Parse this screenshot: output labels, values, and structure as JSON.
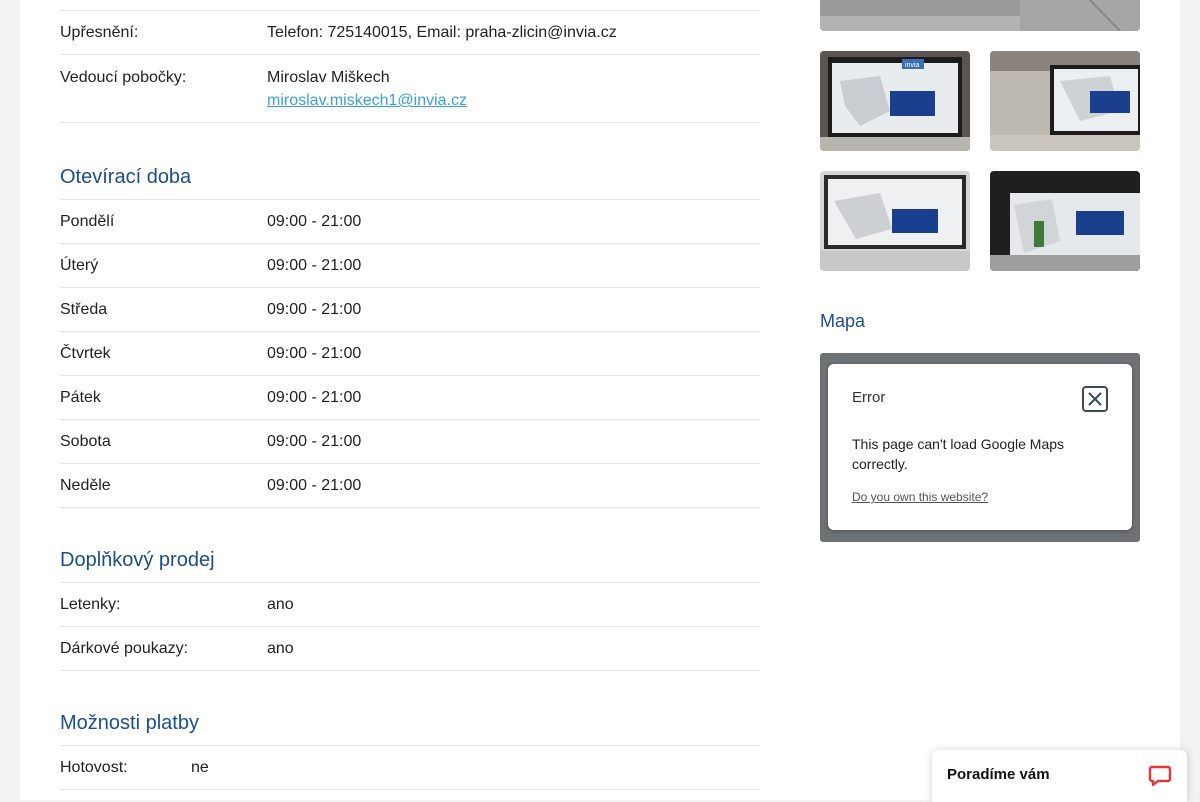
{
  "contact": {
    "upresneni_label": "Upřesnění:",
    "upresneni_value": "Telefon: 725140015, Email: praha-zlicin@invia.cz",
    "manager_label": "Vedoucí pobočky:",
    "manager_name": "Miroslav Miškech",
    "manager_email": "miroslav.miskech1@invia.cz"
  },
  "opening_hours": {
    "title": "Otevírací doba",
    "days": [
      {
        "day": "Pondělí",
        "hours": "09:00 - 21:00"
      },
      {
        "day": "Úterý",
        "hours": "09:00 - 21:00"
      },
      {
        "day": "Středa",
        "hours": "09:00 - 21:00"
      },
      {
        "day": "Čtvrtek",
        "hours": "09:00 - 21:00"
      },
      {
        "day": "Pátek",
        "hours": "09:00 - 21:00"
      },
      {
        "day": "Sobota",
        "hours": "09:00 - 21:00"
      },
      {
        "day": "Neděle",
        "hours": "09:00 - 21:00"
      }
    ]
  },
  "extra_sales": {
    "title": "Doplňkový prodej",
    "items": [
      {
        "label": "Letenky:",
        "value": "ano"
      },
      {
        "label": "Dárkové poukazy:",
        "value": "ano"
      }
    ]
  },
  "payment": {
    "title": "Možnosti platby",
    "items": [
      {
        "label": "Hotovost:",
        "value": "ne"
      }
    ]
  },
  "gallery": {
    "logo_text": "invia"
  },
  "map": {
    "title": "Mapa",
    "error_title": "Error",
    "error_message": "This page can't load Google Maps correctly.",
    "error_link": "Do you own this website?"
  },
  "chat": {
    "label": "Poradíme vám"
  },
  "colors": {
    "heading": "#1b4f8c",
    "link": "#3aa0d8",
    "brand": "#1a3f8f"
  }
}
